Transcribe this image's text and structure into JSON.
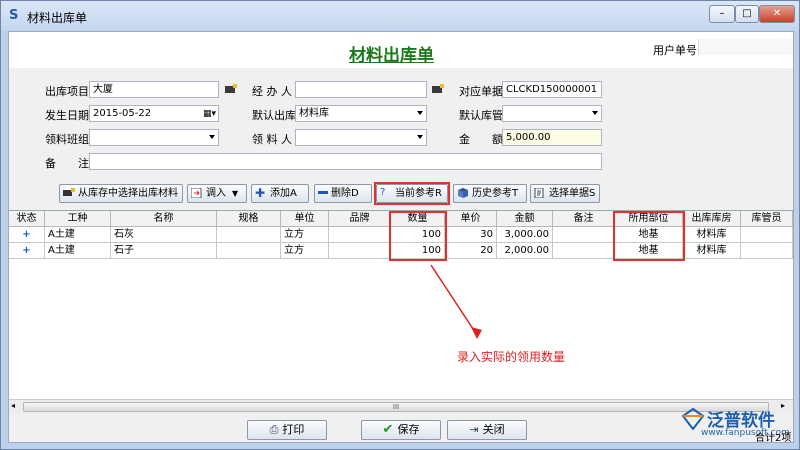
{
  "window": {
    "title": "材料出库单",
    "min_label": "–",
    "max_label": "□",
    "close_label": "✕"
  },
  "header": {
    "doc_title": "材料出库单",
    "user_no_label": "用户单号",
    "user_no_value": ""
  },
  "form": {
    "project_label": "出库项目",
    "project_value": "大厦",
    "handler_label": "经 办 人",
    "handler_value": "",
    "ref_label": "对应单据",
    "ref_value": "CLCKD150000001",
    "date_label": "发生日期",
    "date_value": "2015-05-22",
    "default_out_label": "默认出库",
    "default_out_value": "材料库",
    "default_keeper_label": "默认库管",
    "default_keeper_value": "",
    "team_label": "领料班组",
    "team_value": "",
    "receiver_label": "领 料 人",
    "receiver_value": "",
    "amount_label": "金　　额",
    "amount_value": "5,000.00",
    "remark_label": "备　　注",
    "remark_value": ""
  },
  "toolbar": {
    "from_stock": "从库存中选择出库材料",
    "import": "调入",
    "add": "添加A",
    "delete": "删除D",
    "current_ref": "当前参考R",
    "history_ref": "历史参考T",
    "select_doc": "选择单据S"
  },
  "table": {
    "headers": [
      "状态",
      "工种",
      "名称",
      "规格",
      "单位",
      "品牌",
      "数量",
      "单价",
      "金额",
      "备注",
      "所用部位",
      "出库库房",
      "库管员"
    ],
    "rows": [
      {
        "status": "+",
        "trade": "A土建",
        "name": "石灰",
        "spec": "",
        "unit": "立方",
        "brand": "",
        "qty": "100",
        "price": "30",
        "amount": "3,000.00",
        "remark": "",
        "part": "地基",
        "warehouse": "材料库",
        "keeper": ""
      },
      {
        "status": "+",
        "trade": "A土建",
        "name": "石子",
        "spec": "",
        "unit": "立方",
        "brand": "",
        "qty": "100",
        "price": "20",
        "amount": "2,000.00",
        "remark": "",
        "part": "地基",
        "warehouse": "材料库",
        "keeper": ""
      }
    ]
  },
  "annotation": "录入实际的领用数量",
  "scroll_label": "III",
  "buttons": {
    "print": "打印",
    "save": "保存",
    "close": "关闭"
  },
  "footer": {
    "total": "合计2项",
    "logo_text": "泛普软件",
    "logo_url": "www.fanpusoft.com"
  },
  "colors": {
    "title_green": "#1a7a1a",
    "annotation_red": "#e02020",
    "logo_blue": "#1b5fb0"
  }
}
